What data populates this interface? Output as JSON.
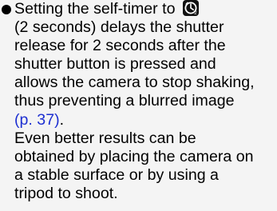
{
  "paragraph1": {
    "line1_pre": "Setting the self-timer to",
    "line2": "(2 seconds) delays the shutter",
    "line3": "release for 2 seconds after the",
    "line4": "shutter button is pressed and",
    "line5": "allows the camera to stop shaking,",
    "line6": "thus preventing a blurred image",
    "link": "(p. 37)",
    "link_suffix": "."
  },
  "paragraph2": {
    "line1": "Even better results can be",
    "line2": "obtained by placing the camera on",
    "line3": "a stable surface or by using a",
    "line4": "tripod to shoot."
  },
  "icons": {
    "bullet": "filled-circle",
    "self_timer": "self-timer-2s-icon"
  },
  "colors": {
    "link": "#1d2fd1",
    "background": "#f4f4f4"
  }
}
